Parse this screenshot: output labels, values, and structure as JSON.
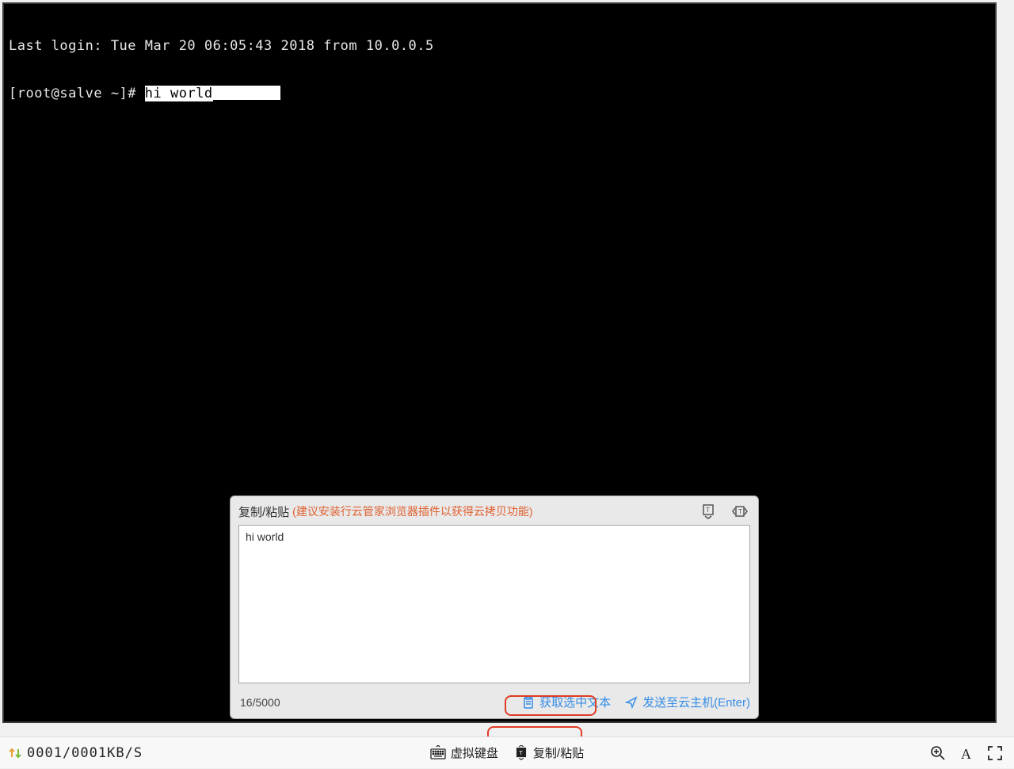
{
  "terminal": {
    "last_login_line": "Last login: Tue Mar 20 06:05:43 2018 from 10.0.0.5",
    "prompt": "[root@salve ~]# ",
    "typed": "hi world"
  },
  "popup": {
    "title": "复制/粘贴",
    "hint": "(建议安装行云管家浏览器插件以获得云拷贝功能)",
    "textarea_value": "hi world",
    "char_count": "16/5000",
    "get_selected_label": "获取选中文本",
    "send_label": "发送至云主机(Enter)"
  },
  "statusbar": {
    "kbps": "0001/0001KB/S",
    "virtual_keyboard": "虚拟键盘",
    "copy_paste": "复制/粘贴"
  },
  "colors": {
    "accent_red": "#e03c24",
    "link_blue": "#358de6",
    "hint_orange": "#e06030"
  }
}
